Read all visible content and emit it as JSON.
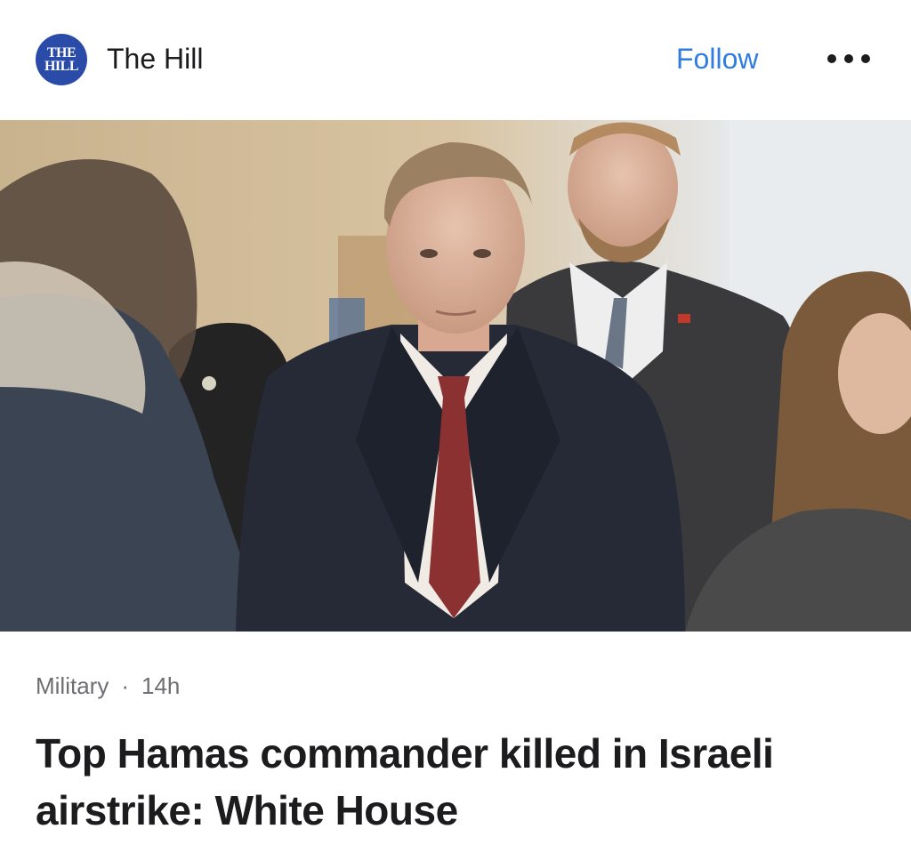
{
  "header": {
    "publisher_name": "The Hill",
    "logo_text_line1": "THE",
    "logo_text_line2": "HILL",
    "follow_label": "Follow",
    "more_icon": "more-horizontal-icon"
  },
  "article": {
    "category": "Military",
    "separator": "·",
    "age": "14h",
    "headline": "Top Hamas commander killed in Israeli airstrike: White House"
  },
  "colors": {
    "accent": "#2f7de1",
    "logo_bg": "#2b4ba8",
    "text": "#1c1c1e",
    "meta_text": "#6e6e73"
  }
}
